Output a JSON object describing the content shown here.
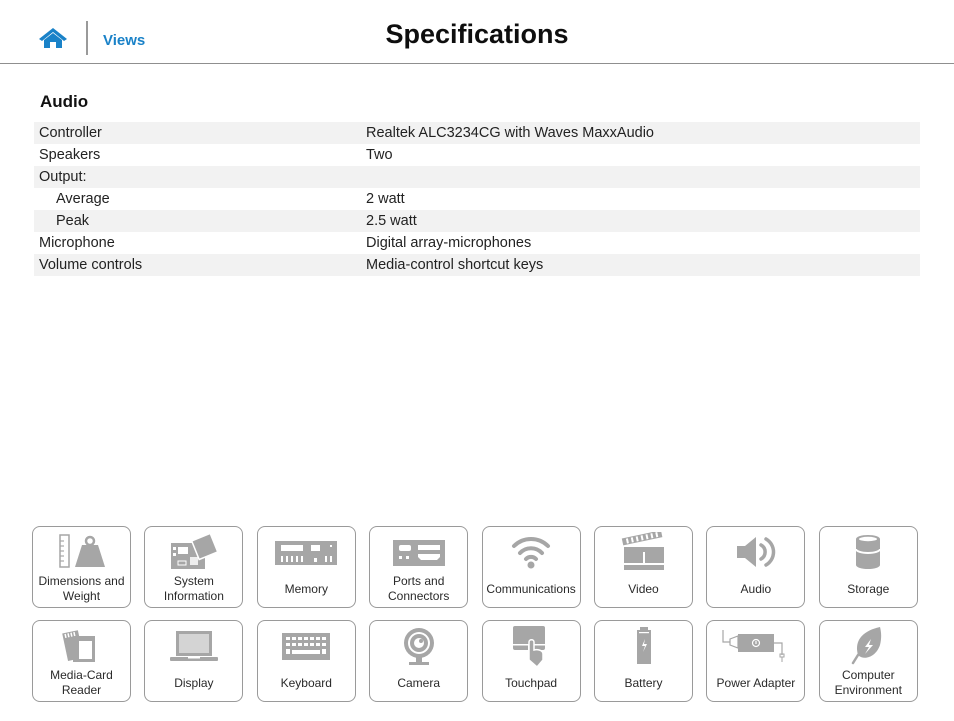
{
  "header": {
    "home_icon": "home-icon",
    "views_label": "Views",
    "title": "Specifications"
  },
  "section": {
    "title": "Audio",
    "rows": [
      {
        "label": "Controller",
        "value": "Realtek ALC3234CG with Waves MaxxAudio",
        "indent": false
      },
      {
        "label": "Speakers",
        "value": "Two",
        "indent": false
      },
      {
        "label": "Output:",
        "value": "",
        "indent": false
      },
      {
        "label": "Average",
        "value": "2 watt",
        "indent": true
      },
      {
        "label": "Peak",
        "value": "2.5 watt",
        "indent": true
      },
      {
        "label": "Microphone",
        "value": "Digital array-microphones",
        "indent": false
      },
      {
        "label": "Volume controls",
        "value": "Media-control shortcut keys",
        "indent": false
      }
    ]
  },
  "tiles": [
    {
      "label": "Dimensions and Weight",
      "icon": "ruler-weight-icon"
    },
    {
      "label": "System Information",
      "icon": "motherboard-icon"
    },
    {
      "label": "Memory",
      "icon": "memory-module-icon"
    },
    {
      "label": "Ports and Connectors",
      "icon": "ports-icon"
    },
    {
      "label": "Communications",
      "icon": "wifi-icon"
    },
    {
      "label": "Video",
      "icon": "clapperboard-icon"
    },
    {
      "label": "Audio",
      "icon": "speaker-icon"
    },
    {
      "label": "Storage",
      "icon": "storage-cylinder-icon"
    },
    {
      "label": "Media-Card Reader",
      "icon": "sd-card-icon"
    },
    {
      "label": "Display",
      "icon": "laptop-display-icon"
    },
    {
      "label": "Keyboard",
      "icon": "keyboard-icon"
    },
    {
      "label": "Camera",
      "icon": "webcam-icon"
    },
    {
      "label": "Touchpad",
      "icon": "touchpad-icon"
    },
    {
      "label": "Battery",
      "icon": "battery-icon"
    },
    {
      "label": "Power Adapter",
      "icon": "power-adapter-icon"
    },
    {
      "label": "Computer Environment",
      "icon": "leaf-icon"
    }
  ],
  "colors": {
    "accent": "#1a82c8",
    "icon_gray": "#a6a6a6",
    "row_stripe": "#f2f2f2",
    "tile_border": "#9a9a9a"
  }
}
